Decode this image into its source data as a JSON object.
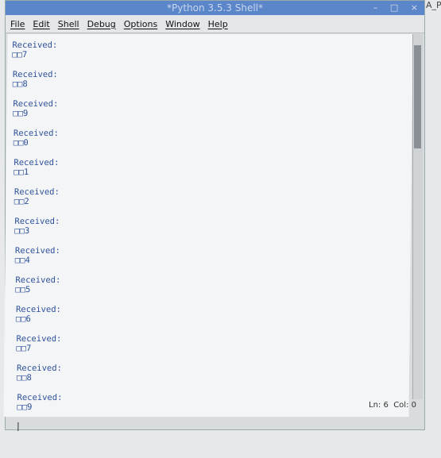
{
  "window": {
    "title": "*Python 3.5.3 Shell*",
    "controls": [
      "–",
      "□",
      "×"
    ]
  },
  "side_text": "A_P",
  "menu": [
    "File",
    "Edit",
    "Shell",
    "Debug",
    "Options",
    "Window",
    "Help"
  ],
  "output": [
    {
      "label": "Received:",
      "value": "□□7"
    },
    {
      "label": "Received:",
      "value": "□□8"
    },
    {
      "label": "Received:",
      "value": "□□9"
    },
    {
      "label": "Received:",
      "value": "□□0"
    },
    {
      "label": "Received:",
      "value": "□□1"
    },
    {
      "label": "Received:",
      "value": "□□2"
    },
    {
      "label": "Received:",
      "value": "□□3"
    },
    {
      "label": "Received:",
      "value": "□□4"
    },
    {
      "label": "Received:",
      "value": "□□5"
    },
    {
      "label": "Received:",
      "value": "□□6"
    },
    {
      "label": "Received:",
      "value": "□□7"
    },
    {
      "label": "Received:",
      "value": "□□8"
    },
    {
      "label": "Received:",
      "value": "□□9"
    }
  ],
  "status": {
    "ln": "Ln: 6",
    "col": "Col: 0"
  }
}
